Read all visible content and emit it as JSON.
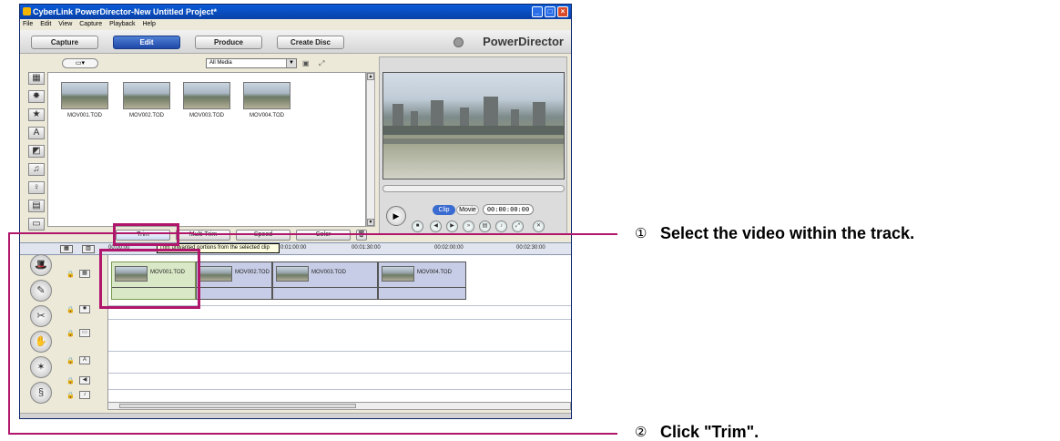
{
  "window": {
    "title": "CyberLink PowerDirector-New Untitled Project*"
  },
  "menu": [
    "File",
    "Edit",
    "View",
    "Capture",
    "Playback",
    "Help"
  ],
  "toolbar": {
    "capture_label": "Capture",
    "edit_label": "Edit",
    "produce_label": "Produce",
    "create_disc_label": "Create Disc",
    "brand": "PowerDirector"
  },
  "library": {
    "filter_value": "All Media",
    "clips": [
      "MOV001.TOD",
      "MOV002.TOD",
      "MOV003.TOD",
      "MOV004.TOD"
    ]
  },
  "modes": {
    "trim_label": "Trim",
    "multi_trim_label": "Multi Trim",
    "speed_label": "Speed",
    "color_label": "Color"
  },
  "preview": {
    "clip_label": "Clip",
    "movie_label": "Movie",
    "timecode": "00:00:00:00"
  },
  "timeline": {
    "ticks": [
      "00:00:00",
      "0:01:00:00",
      "00:01:30:00",
      "00:02:00:00",
      "00:02:30:00"
    ],
    "tooltip": "Trim unwanted portions from the selected clip",
    "clips": [
      "MOV001.TOD",
      "MOV002.TOD",
      "MOV003.TOD",
      "MOV004.TOD"
    ]
  },
  "callouts": {
    "step1_num": "①",
    "step1_text": "Select the video within the track.",
    "step2_num": "②",
    "step2_text": "Click \"Trim\"."
  },
  "colors": {
    "callout": "#b0166b",
    "titlebar": "#0a5bd8",
    "active_tab": "#1f4aa8"
  }
}
